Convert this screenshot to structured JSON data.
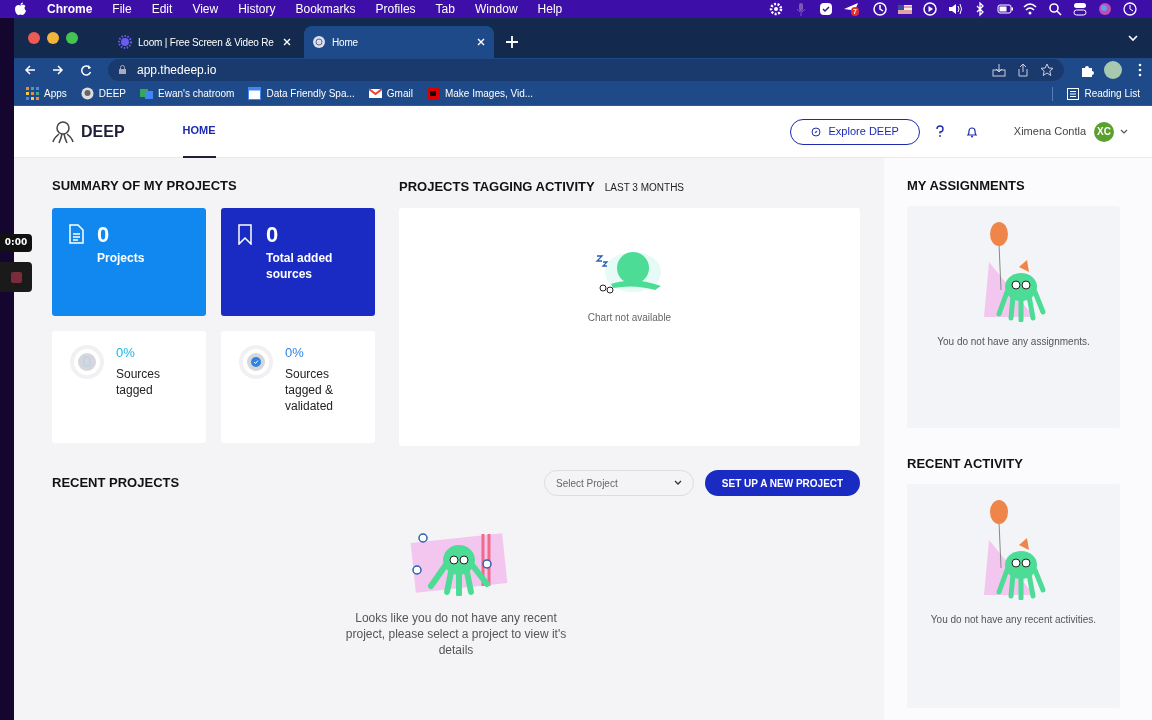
{
  "menubar": {
    "app": "Chrome",
    "items": [
      "File",
      "Edit",
      "View",
      "History",
      "Bookmarks",
      "Profiles",
      "Tab",
      "Window",
      "Help"
    ],
    "badge": "7"
  },
  "browser": {
    "tabs": [
      {
        "title": "Loom | Free Screen & Video Re",
        "selected": false
      },
      {
        "title": "Home",
        "selected": true
      }
    ],
    "url": "app.thedeep.io",
    "bookmarks": [
      "Apps",
      "DEEP",
      "Ewan's chatroom",
      "Data Friendly Spa...",
      "Gmail",
      "Make Images, Vid..."
    ],
    "reading_list": "Reading List"
  },
  "recording": {
    "time": "0:00"
  },
  "header": {
    "brand": "DEEP",
    "nav": [
      {
        "label": "HOME",
        "selected": true
      }
    ],
    "explore_button": "Explore DEEP",
    "user": "Ximena Contla",
    "avatar": "XC"
  },
  "summary": {
    "title": "SUMMARY OF MY PROJECTS",
    "stat_cards": [
      {
        "kind": "projects",
        "value": "0",
        "label": "Projects"
      },
      {
        "kind": "sources",
        "value": "0",
        "label": "Total added sources"
      }
    ],
    "progress_cards": [
      {
        "kind": "tagged",
        "value": "0%",
        "label": "Sources tagged"
      },
      {
        "kind": "validated",
        "value": "0%",
        "label": "Sources tagged & validated"
      }
    ]
  },
  "tagging_activity": {
    "title": "PROJECTS TAGGING ACTIVITY",
    "period": "LAST 3 MONTHS",
    "empty_text": "Chart not available"
  },
  "recent_projects": {
    "title": "RECENT PROJECTS",
    "select": {
      "placeholder": "Select Project"
    },
    "button": "SET UP A NEW PROJECT",
    "empty_text": "Looks like you do not have any recent project, please select a project to view it's details"
  },
  "assignments": {
    "title": "MY ASSIGNMENTS",
    "empty_text": "You do not have any assignments."
  },
  "recent_activity": {
    "title": "RECENT ACTIVITY",
    "empty_text": "You do not have any recent activities."
  }
}
